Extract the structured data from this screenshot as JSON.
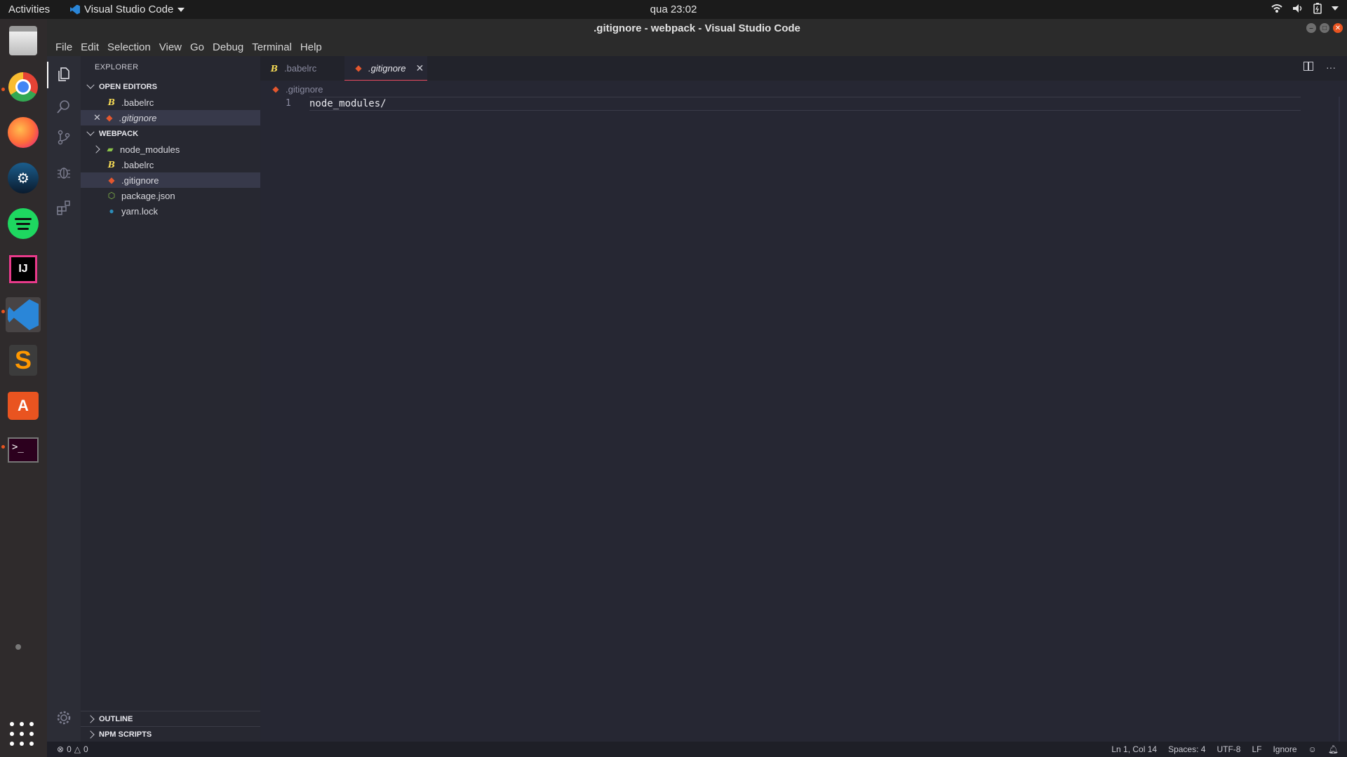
{
  "topbar": {
    "activities": "Activities",
    "app_name": "Visual Studio Code",
    "clock": "qua 23:02"
  },
  "dock": {
    "items": [
      {
        "name": "files",
        "icon": "file-manager-icon"
      },
      {
        "name": "chrome",
        "icon": "chrome-icon"
      },
      {
        "name": "firefox",
        "icon": "firefox-icon"
      },
      {
        "name": "steam",
        "icon": "steam-icon"
      },
      {
        "name": "spotify",
        "icon": "spotify-icon"
      },
      {
        "name": "intellij",
        "icon": "intellij-icon",
        "label": "IJ"
      },
      {
        "name": "vscode",
        "icon": "vscode-icon"
      },
      {
        "name": "sublime",
        "icon": "sublime-icon",
        "label": "S"
      },
      {
        "name": "software",
        "icon": "software-center-icon",
        "label": "A"
      },
      {
        "name": "terminal",
        "icon": "terminal-icon",
        "label": ">_"
      }
    ]
  },
  "window": {
    "title": ".gitignore - webpack - Visual Studio Code"
  },
  "menu": [
    "File",
    "Edit",
    "Selection",
    "View",
    "Go",
    "Debug",
    "Terminal",
    "Help"
  ],
  "sidebar": {
    "title": "EXPLORER",
    "open_editors_label": "OPEN EDITORS",
    "open_editors": [
      ".babelrc",
      ".gitignore"
    ],
    "project_label": "WEBPACK",
    "files": [
      "node_modules",
      ".babelrc",
      ".gitignore",
      "package.json",
      "yarn.lock"
    ],
    "outline_label": "OUTLINE",
    "npm_label": "NPM SCRIPTS"
  },
  "editor": {
    "tabs": [
      ".babelrc",
      ".gitignore"
    ],
    "active_tab": ".gitignore",
    "breadcrumb": ".gitignore",
    "line_number": "1",
    "line_text": "node_modules/"
  },
  "status": {
    "errors": "0",
    "warnings": "0",
    "position": "Ln 1, Col 14",
    "spaces": "Spaces: 4",
    "encoding": "UTF-8",
    "eol": "LF",
    "language": "Ignore"
  },
  "colors": {
    "accent_orange": "#e95420",
    "git_icon": "#e4572e",
    "babel_icon": "#f5da55",
    "active_tab_underline": "#e84a5f"
  }
}
